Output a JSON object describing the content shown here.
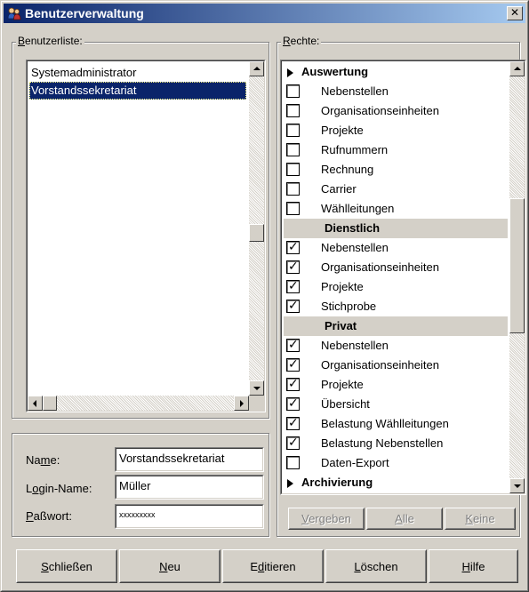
{
  "window": {
    "title": "Benutzerverwaltung",
    "close_label": "✕"
  },
  "users": {
    "group_label_accel": "B",
    "group_label_rest": "enutzerliste:",
    "items": [
      {
        "label": "Systemadministrator",
        "selected": false
      },
      {
        "label": "Vorstandssekretariat",
        "selected": true
      }
    ]
  },
  "rights": {
    "group_label_accel": "R",
    "group_label_rest": "echte:",
    "rows": [
      {
        "type": "section",
        "label": "Auswertung"
      },
      {
        "type": "item",
        "label": "Nebenstellen",
        "checked": false
      },
      {
        "type": "item",
        "label": "Organisationseinheiten",
        "checked": false
      },
      {
        "type": "item",
        "label": "Projekte",
        "checked": false
      },
      {
        "type": "item",
        "label": "Rufnummern",
        "checked": false
      },
      {
        "type": "item",
        "label": "Rechnung",
        "checked": false
      },
      {
        "type": "item",
        "label": "Carrier",
        "checked": false
      },
      {
        "type": "item",
        "label": "Wählleitungen",
        "checked": false
      },
      {
        "type": "subheader",
        "label": "Dienstlich"
      },
      {
        "type": "item",
        "label": "Nebenstellen",
        "checked": true
      },
      {
        "type": "item",
        "label": "Organisationseinheiten",
        "checked": true
      },
      {
        "type": "item",
        "label": "Projekte",
        "checked": true
      },
      {
        "type": "item",
        "label": "Stichprobe",
        "checked": true
      },
      {
        "type": "subheader",
        "label": "Privat"
      },
      {
        "type": "item",
        "label": "Nebenstellen",
        "checked": true
      },
      {
        "type": "item",
        "label": "Organisationseinheiten",
        "checked": true
      },
      {
        "type": "item",
        "label": "Projekte",
        "checked": true
      },
      {
        "type": "item",
        "label": "Übersicht",
        "checked": true
      },
      {
        "type": "item",
        "label": "Belastung Wählleitungen",
        "checked": true
      },
      {
        "type": "item",
        "label": "Belastung Nebenstellen",
        "checked": true
      },
      {
        "type": "item",
        "label": "Daten-Export",
        "checked": false
      },
      {
        "type": "section",
        "label": "Archivierung"
      }
    ],
    "buttons": {
      "assign_accel": "V",
      "assign_rest": "ergeben",
      "all_accel": "A",
      "all_rest": "lle",
      "none_accel": "K",
      "none_rest": "eine"
    }
  },
  "form": {
    "name_label_pre": "Na",
    "name_label_accel": "m",
    "name_label_post": "e:",
    "name_value": "Vorstandssekretariat",
    "login_label_pre": "L",
    "login_label_accel": "o",
    "login_label_post": "gin-Name:",
    "login_value": "Müller",
    "password_label_accel": "P",
    "password_label_rest": "aßwort:",
    "password_value": "xxxxxxxxx"
  },
  "actions": {
    "close_accel": "S",
    "close_rest": "chließen",
    "new_accel": "N",
    "new_rest": "eu",
    "edit_pre": "E",
    "edit_accel": "d",
    "edit_post": "itieren",
    "delete_accel": "L",
    "delete_rest": "öschen",
    "help_accel": "H",
    "help_rest": "ilfe"
  }
}
